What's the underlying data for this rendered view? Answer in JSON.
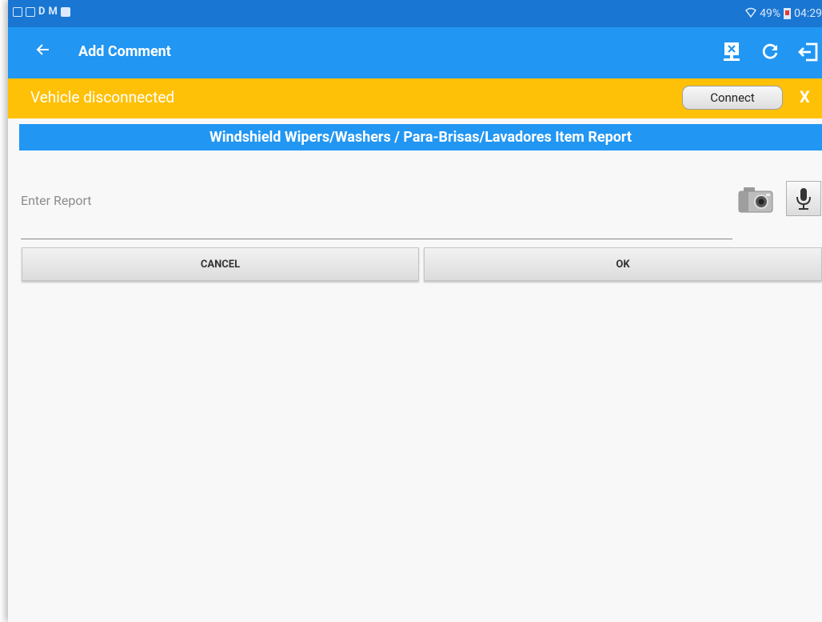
{
  "status_bar": {
    "left_letters": [
      "D",
      "M"
    ],
    "battery": "49%",
    "time": "04:29"
  },
  "app_bar": {
    "title": "Add Comment",
    "icons": [
      "back-arrow-icon",
      "disconnect-device-icon",
      "refresh-icon",
      "logout-icon"
    ]
  },
  "banner": {
    "text": "Vehicle disconnected",
    "connect_label": "Connect",
    "close_label": "X"
  },
  "report": {
    "header": "Windshield Wipers/Washers / Para-Brisas/Lavadores Item Report",
    "placeholder": "Enter Report",
    "value": ""
  },
  "buttons": {
    "cancel": "CANCEL",
    "ok": "OK"
  },
  "colors": {
    "status_bar": "#1976d2",
    "primary": "#2196f3",
    "banner": "#ffc107",
    "background": "#f8f8f8"
  }
}
